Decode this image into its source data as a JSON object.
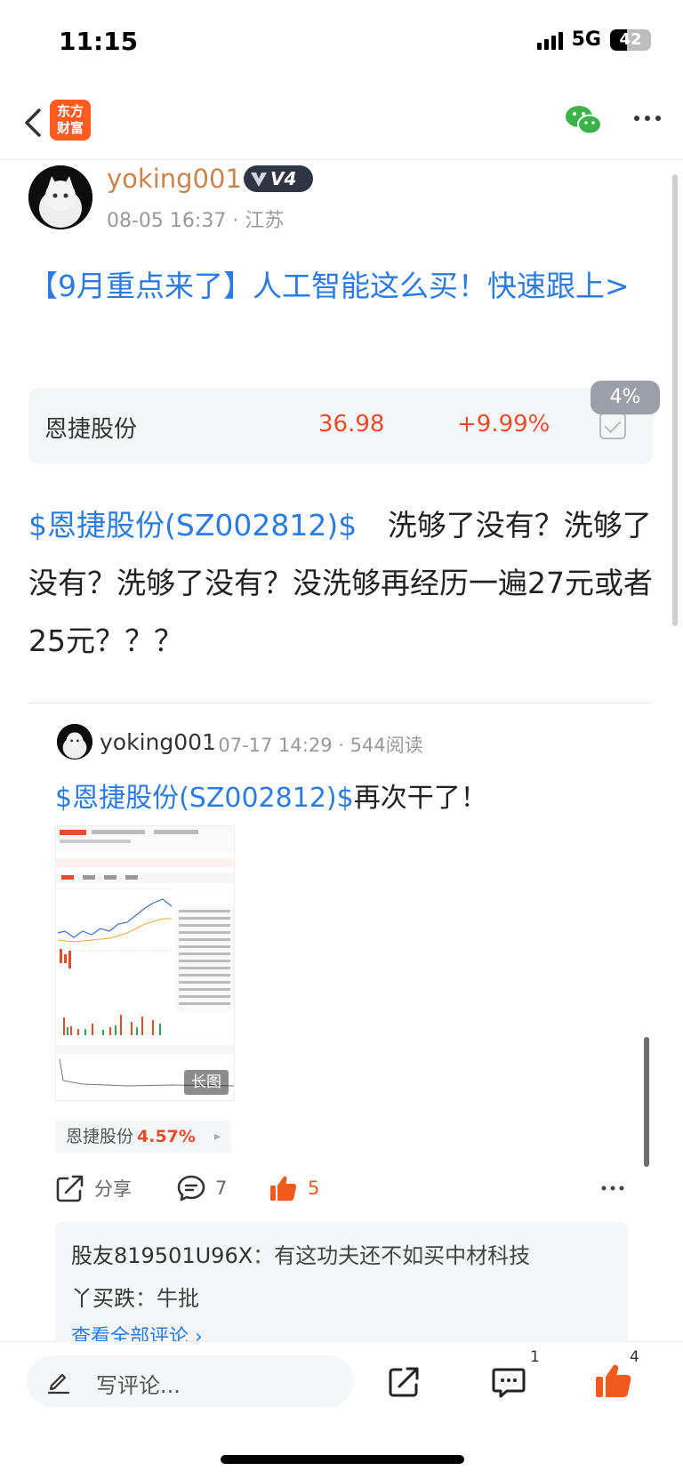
{
  "status_bar": {
    "time": "11:15",
    "network": "5G",
    "battery": "42",
    "battery_level_percent": 42
  },
  "app": {
    "logo_line1": "东方",
    "logo_line2": "财富"
  },
  "post": {
    "author": "yoking001",
    "level": "V4",
    "date": "08-05 16:37",
    "location": "江苏",
    "headline": "【9月重点来了】人工智能这么买！快速跟上>",
    "stock_card": {
      "name": "恩捷股份",
      "price": "36.98",
      "change": "+9.99%",
      "bubble": "4%"
    },
    "body_tag": "$恩捷股份(SZ002812)$",
    "body_text": "洗够了没有？洗够了没有？洗够了没有？没洗够再经历一遍27元或者25元？？？"
  },
  "repost": {
    "author": "yoking001",
    "date": "07-17 14:29",
    "reads": "544阅读",
    "tag": "$恩捷股份(SZ002812)$",
    "text": "再次干了！",
    "image_tag": "长图",
    "chip_name": "恩捷股份",
    "chip_change": "4.57%"
  },
  "actions": {
    "share_label": "分享",
    "comment_count": "7",
    "like_count": "5"
  },
  "comments": [
    {
      "user": "股友819501U96X",
      "sep": "：",
      "text": "有这功夫还不如买中材科技"
    },
    {
      "user": "丫买跌",
      "sep": "：",
      "text": "牛批"
    }
  ],
  "comments_more": "查看全部评论 ›",
  "bottom_bar": {
    "placeholder": "写评论...",
    "comment_badge": "1",
    "like_badge": "4"
  },
  "colors": {
    "brand": "#ff5a1f",
    "link": "#2b7be0",
    "up": "#e84d2b",
    "author": "#c8864e"
  },
  "icons": [
    "back-icon",
    "wechat-icon",
    "more-icon",
    "share-icon",
    "comment-icon",
    "like-icon",
    "pen-icon"
  ]
}
